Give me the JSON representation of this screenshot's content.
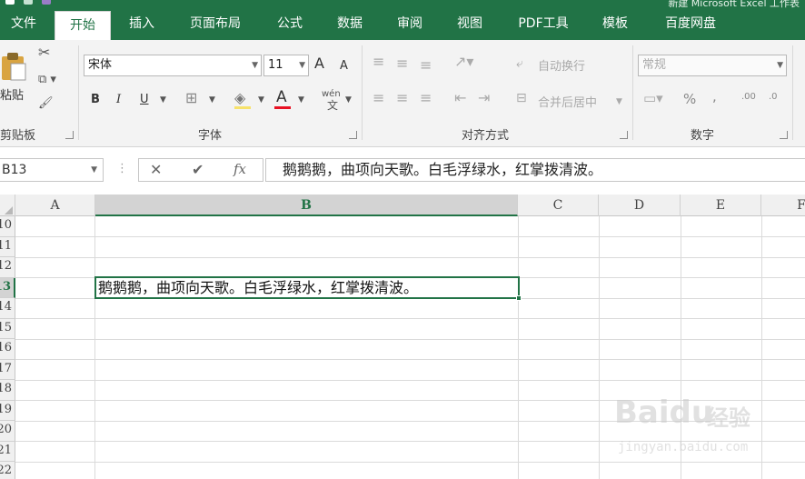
{
  "title_bar": {
    "title": "新建 Microsoft Excel 工作表"
  },
  "tabs": [
    {
      "label": "文件"
    },
    {
      "label": "开始"
    },
    {
      "label": "插入"
    },
    {
      "label": "页面布局"
    },
    {
      "label": "公式"
    },
    {
      "label": "数据"
    },
    {
      "label": "审阅"
    },
    {
      "label": "视图"
    },
    {
      "label": "PDF工具"
    },
    {
      "label": "模板"
    },
    {
      "label": "百度网盘"
    }
  ],
  "ribbon": {
    "clipboard": {
      "paste_label": "粘贴",
      "group_label": "剪贴板"
    },
    "font": {
      "font_name": "宋体",
      "font_size": "11",
      "bold": "B",
      "italic": "I",
      "underline": "U",
      "font_color_letter": "A",
      "phonetic": "wén",
      "grow": "A",
      "shrink": "A",
      "group_label": "字体",
      "accent_color": "#e81123"
    },
    "alignment": {
      "wrap_label": "自动换行",
      "merge_label": "合并后居中",
      "group_label": "对齐方式"
    },
    "number": {
      "format": "常规",
      "percent": "%",
      "comma": ",",
      "inc_decimal": ".00",
      "dec_decimal": ".0",
      "group_label": "数字"
    }
  },
  "formula_bar": {
    "name_box": "B13",
    "cancel": "✕",
    "enter": "✔",
    "fx": "fx",
    "content": "鹅鹅鹅，曲项向天歌。白毛浮绿水，红掌拨清波。"
  },
  "sheet": {
    "columns": [
      "A",
      "B",
      "C",
      "D",
      "E",
      "F"
    ],
    "selected_column": "B",
    "rows": [
      "10",
      "11",
      "12",
      "13",
      "14",
      "15",
      "16",
      "17",
      "18",
      "19",
      "20",
      "21",
      "22"
    ],
    "selected_row": "13",
    "active_cell_text": "鹅鹅鹅，曲项向天歌。白毛浮绿水，红掌拨清波。"
  },
  "watermark": {
    "brand": "Baidu",
    "suffix": "经验",
    "url": "jingyan.baidu.com"
  },
  "colors": {
    "accent": "#217346",
    "font_red": "#e81123"
  }
}
